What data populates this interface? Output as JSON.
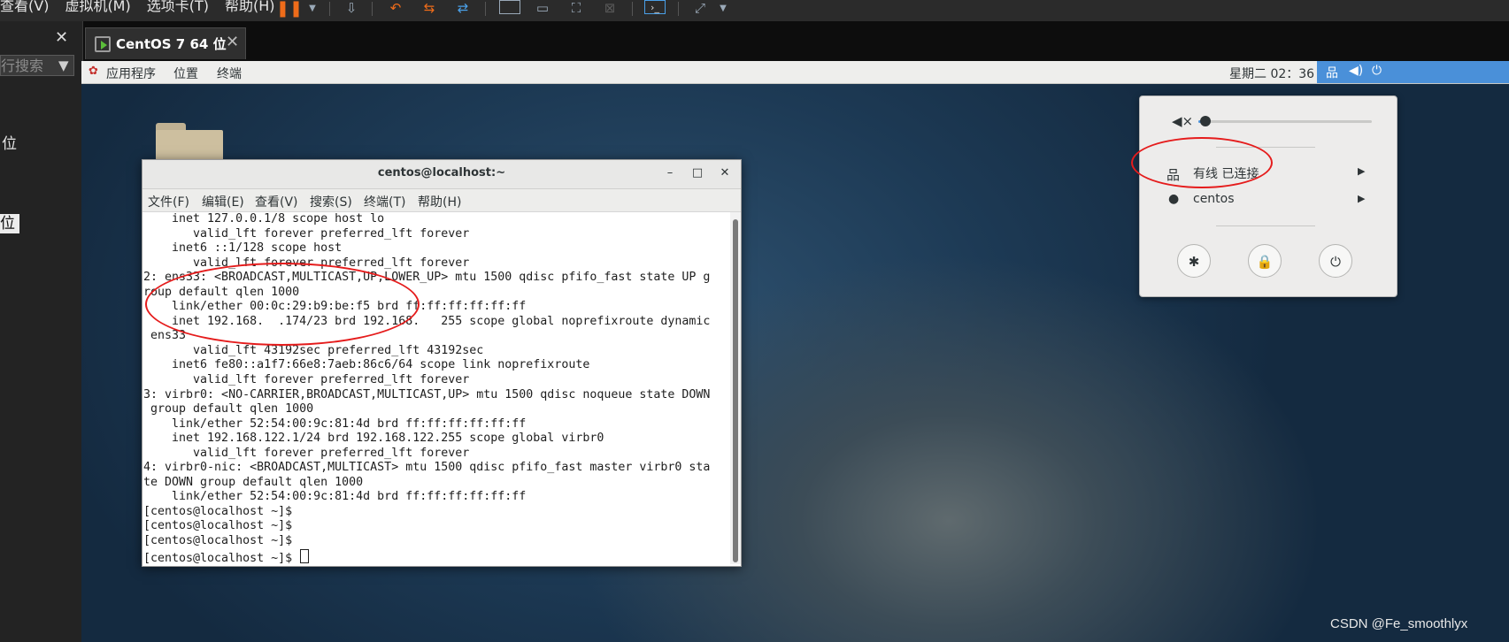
{
  "vm_toolbar": {
    "menus": [
      "查看(V)",
      "虚拟机(M)",
      "选项卡(T)",
      "帮助(H)"
    ],
    "icons": [
      "pause-icon",
      "send-keys-icon",
      "snapshot-icon",
      "revert-icon",
      "snapshot-manager-icon",
      "fullscreen-icon",
      "unity-icon",
      "console-icon",
      "view-icon"
    ],
    "accent": "#ef6c1a"
  },
  "library": {
    "search_placeholder": "行搜索",
    "item_1": "位",
    "item_2": "位"
  },
  "vm_tab": {
    "label": "CentOS 7 64 位",
    "close": "✕"
  },
  "gnome_topbar": {
    "apps": "应用程序",
    "places": "位置",
    "terminal": "终端",
    "clock": "星期二 02：36",
    "indicator_color": "#4a90d9"
  },
  "terminal": {
    "title": "centos@localhost:~",
    "buttons": {
      "minimize": "–",
      "maximize": "□",
      "close": "✕"
    },
    "menu": [
      "文件(F)",
      "编辑(E)",
      "查看(V)",
      "搜索(S)",
      "终端(T)",
      "帮助(H)"
    ],
    "lines": [
      "    inet 127.0.0.1/8 scope host lo",
      "       valid_lft forever preferred_lft forever",
      "    inet6 ::1/128 scope host",
      "       valid_lft forever preferred_lft forever",
      "2: ens33: <BROADCAST,MULTICAST,UP,LOWER_UP> mtu 1500 qdisc pfifo_fast state UP g",
      "roup default qlen 1000",
      "    link/ether 00:0c:29:b9:be:f5 brd ff:ff:ff:ff:ff:ff",
      "    inet 192.168.  .174/23 brd 192.168.   255 scope global noprefixroute dynamic",
      " ens33",
      "       valid_lft 43192sec preferred_lft 43192sec",
      "    inet6 fe80::a1f7:66e8:7aeb:86c6/64 scope link noprefixroute",
      "       valid_lft forever preferred_lft forever",
      "3: virbr0: <NO-CARRIER,BROADCAST,MULTICAST,UP> mtu 1500 qdisc noqueue state DOWN",
      " group default qlen 1000",
      "    link/ether 52:54:00:9c:81:4d brd ff:ff:ff:ff:ff:ff",
      "    inet 192.168.122.1/24 brd 192.168.122.255 scope global virbr0",
      "       valid_lft forever preferred_lft forever",
      "4: virbr0-nic: <BROADCAST,MULTICAST> mtu 1500 qdisc pfifo_fast master virbr0 sta",
      "te DOWN group default qlen 1000",
      "    link/ether 52:54:00:9c:81:4d brd ff:ff:ff:ff:ff:ff",
      "[centos@localhost ~]$",
      "[centos@localhost ~]$",
      "[centos@localhost ~]$",
      "[centos@localhost ~]$ "
    ]
  },
  "system_menu": {
    "volume_level": 0.04,
    "wired": "有线 已连接",
    "user": "centos",
    "buttons": [
      "settings-icon",
      "lock-icon",
      "power-off-icon"
    ]
  },
  "annotation_color": "#e51c1c",
  "watermark": "CSDN @Fe_smoothlyx"
}
